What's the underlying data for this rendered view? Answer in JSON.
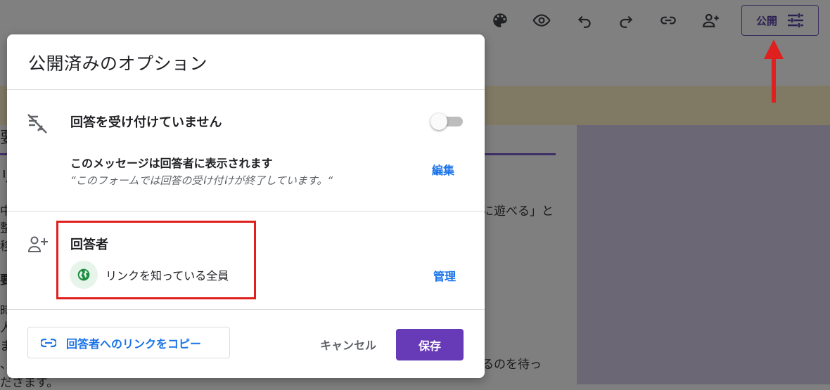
{
  "toolbar": {
    "icons": [
      "palette-icon",
      "eye-icon",
      "undo-icon",
      "redo-icon",
      "link-icon",
      "add-person-icon"
    ],
    "publish_label": "公開"
  },
  "background": {
    "snippets": [
      "要",
      "リ",
      "中",
      "整",
      "移",
      "要",
      "時",
      "人",
      "ま",
      "、",
      "ださます。",
      "に遊べる」と",
      "るのを待っ"
    ]
  },
  "dialog": {
    "title": "公開済みのオプション",
    "responses": {
      "title": "回答を受け付けていません",
      "toggle_on": false,
      "message_label": "このメッセージは回答者に表示されます",
      "message_quote": "“このフォームでは回答の受け付けが終了しています。“",
      "edit_label": "編集"
    },
    "respondents": {
      "title": "回答者",
      "audience": "リンクを知っている全員",
      "manage_label": "管理"
    },
    "footer": {
      "copy_link_label": "回答者へのリンクをコピー",
      "cancel_label": "キャンセル",
      "save_label": "保存"
    }
  },
  "colors": {
    "accent": "#673ab7",
    "link": "#1a73e8",
    "annotation": "#e0201e"
  }
}
